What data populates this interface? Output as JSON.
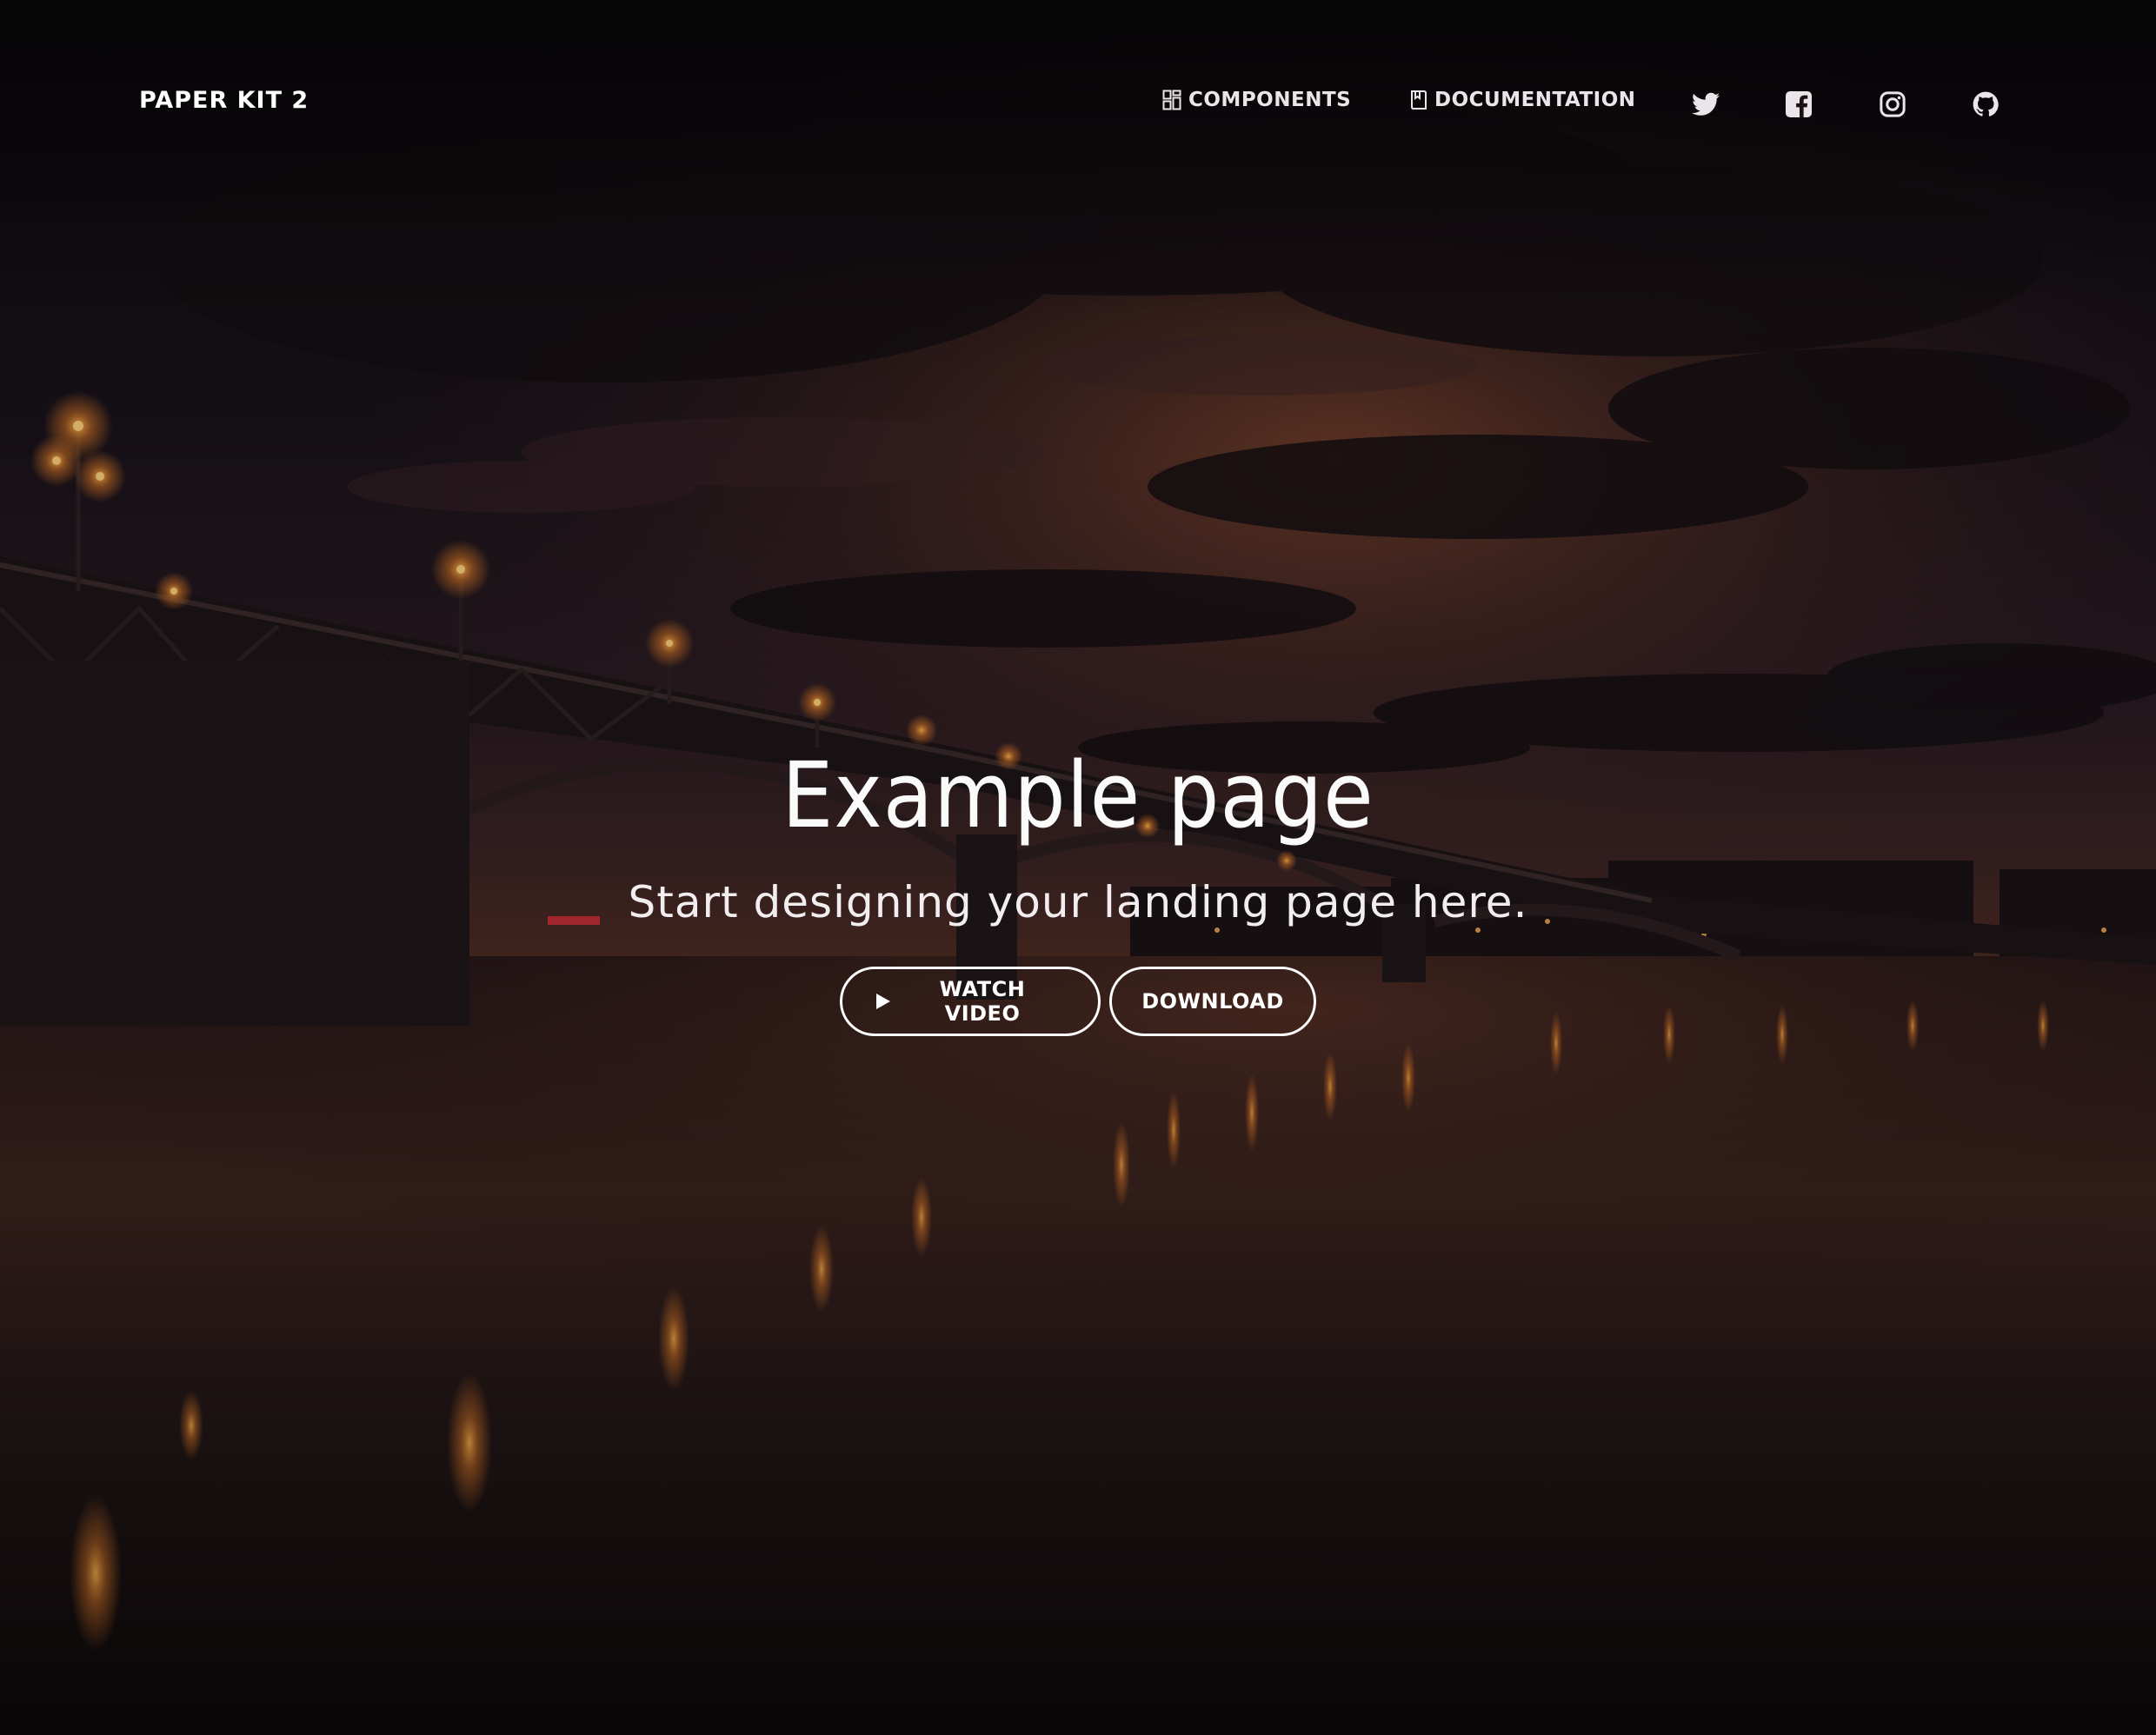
{
  "navbar": {
    "brand": "PAPER KIT 2",
    "links": [
      {
        "label": "COMPONENTS",
        "icon": "layout-grid-icon"
      },
      {
        "label": "DOCUMENTATION",
        "icon": "book-icon"
      }
    ],
    "social": [
      {
        "name": "twitter",
        "icon": "twitter-icon"
      },
      {
        "name": "facebook",
        "icon": "facebook-square-icon"
      },
      {
        "name": "instagram",
        "icon": "instagram-icon"
      },
      {
        "name": "github",
        "icon": "github-icon"
      }
    ]
  },
  "hero": {
    "title": "Example page",
    "subtitle": "Start designing your landing page here.",
    "buttons": {
      "watch_video": {
        "label": "WATCH VIDEO",
        "icon": "play-icon"
      },
      "download": {
        "label": "DOWNLOAD"
      }
    }
  },
  "colors": {
    "text": "#ffffff",
    "button_border": "#ffffff",
    "sky_glow": "#c0613a"
  }
}
